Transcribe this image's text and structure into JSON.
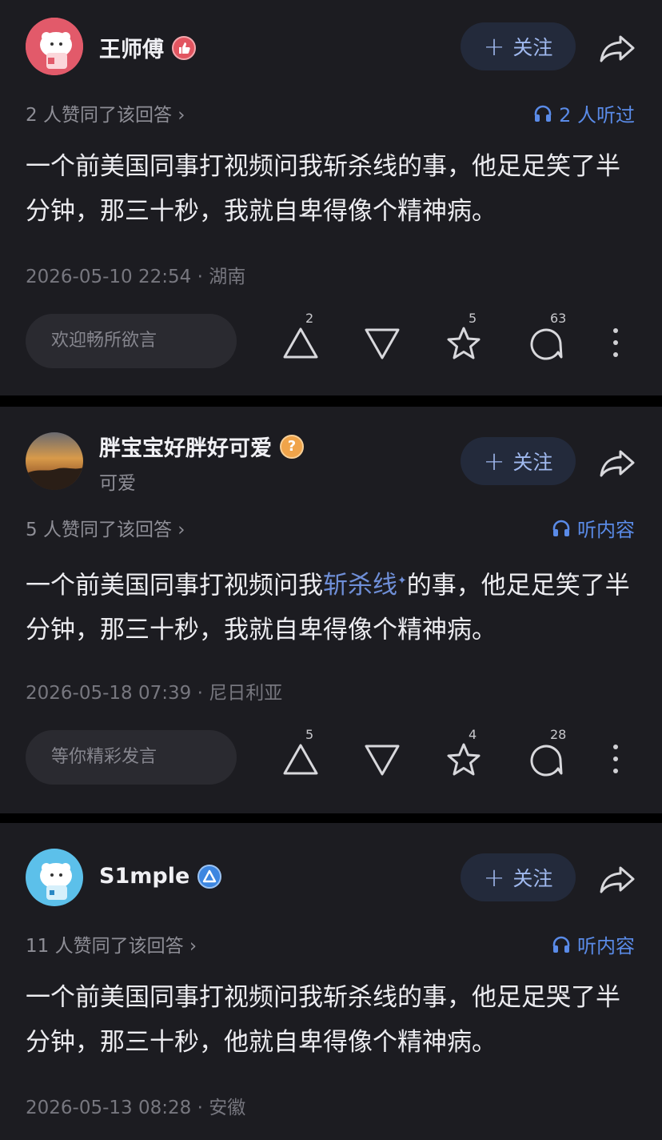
{
  "follow_label": "关注",
  "answers": [
    {
      "user": {
        "name": "王师傅",
        "badge_icon": "thumbs-up-badge-icon",
        "subtitle": ""
      },
      "agree_text": "2 人赞同了该回答 ›",
      "listen_text": "2 人听过",
      "content_html": false,
      "content": "一个前美国同事打视频问我斩杀线的事，他足足笑了半分钟，那三十秒，我就自卑得像个精神病。",
      "meta": "2026-05-10 22:54 · 湖南",
      "comment_placeholder": "欢迎畅所欲言",
      "upvotes": "2",
      "favorites": "5",
      "comments": "63"
    },
    {
      "user": {
        "name": "胖宝宝好胖好可爱",
        "badge_icon": "question-badge-icon",
        "subtitle": "可爱"
      },
      "agree_text": "5 人赞同了该回答 ›",
      "listen_text": "听内容",
      "content_parts": [
        "一个前美国同事打视频问我",
        "斩杀线",
        "✦",
        "的事，他足足笑了半分钟，那三十秒，我就自卑得像个精神病。"
      ],
      "meta": "2026-05-18 07:39 · 尼日利亚",
      "comment_placeholder": "等你精彩发言",
      "upvotes": "5",
      "favorites": "4",
      "comments": "28"
    },
    {
      "user": {
        "name": "S1mple",
        "badge_icon": "triangle-badge-icon",
        "subtitle": ""
      },
      "agree_text": "11 人赞同了该回答 ›",
      "listen_text": "听内容",
      "content": "一个前美国同事打视频问我斩杀线的事，他足足哭了半分钟，那三十秒，他就自卑得像个精神病。",
      "meta": "2026-05-13 08:28 · 安徽"
    }
  ],
  "colors": {
    "card_bg": "#1c1c21",
    "accent": "#5a8be8",
    "follow_bg": "#232a3b",
    "follow_text": "#9fb8ee"
  }
}
